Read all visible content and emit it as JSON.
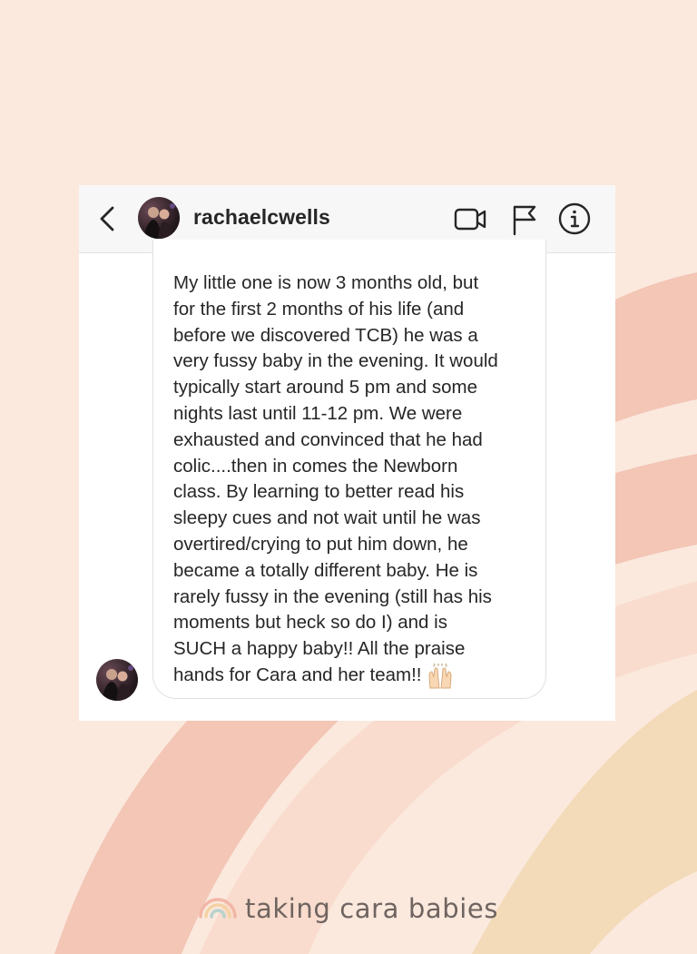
{
  "conversation": {
    "username": "rachaelcwells",
    "message": "My little one is now 3 months old, but\nfor the first 2 months of his life (and\nbefore we discovered TCB) he was a\nvery fussy baby in the evening. It would\ntypically start around 5 pm and some\nnights last until 11-12 pm. We were\nexhausted and convinced that he had\ncolic....then in comes the Newborn\nclass. By learning to better read his\nsleepy cues and not wait until he was\novertired/crying to put him down, he\nbecame a totally different baby. He is\nrarely fussy in the evening (still has his\nmoments but heck so do I) and is\nSUCH a happy baby!! All the praise\nhands for Cara and her team!!",
    "emoji": "raising-hands"
  },
  "header_icons": [
    "back-chevron-icon",
    "video-camera-icon",
    "flag-icon",
    "info-icon"
  ],
  "brand": {
    "name": "taking cara babies",
    "colors": {
      "background": "#fbe9de",
      "arc_pink": "#f2c2b3",
      "arc_peach": "#f8d9ca",
      "arc_sand": "#f3dab8",
      "text": "#6f6460"
    }
  }
}
